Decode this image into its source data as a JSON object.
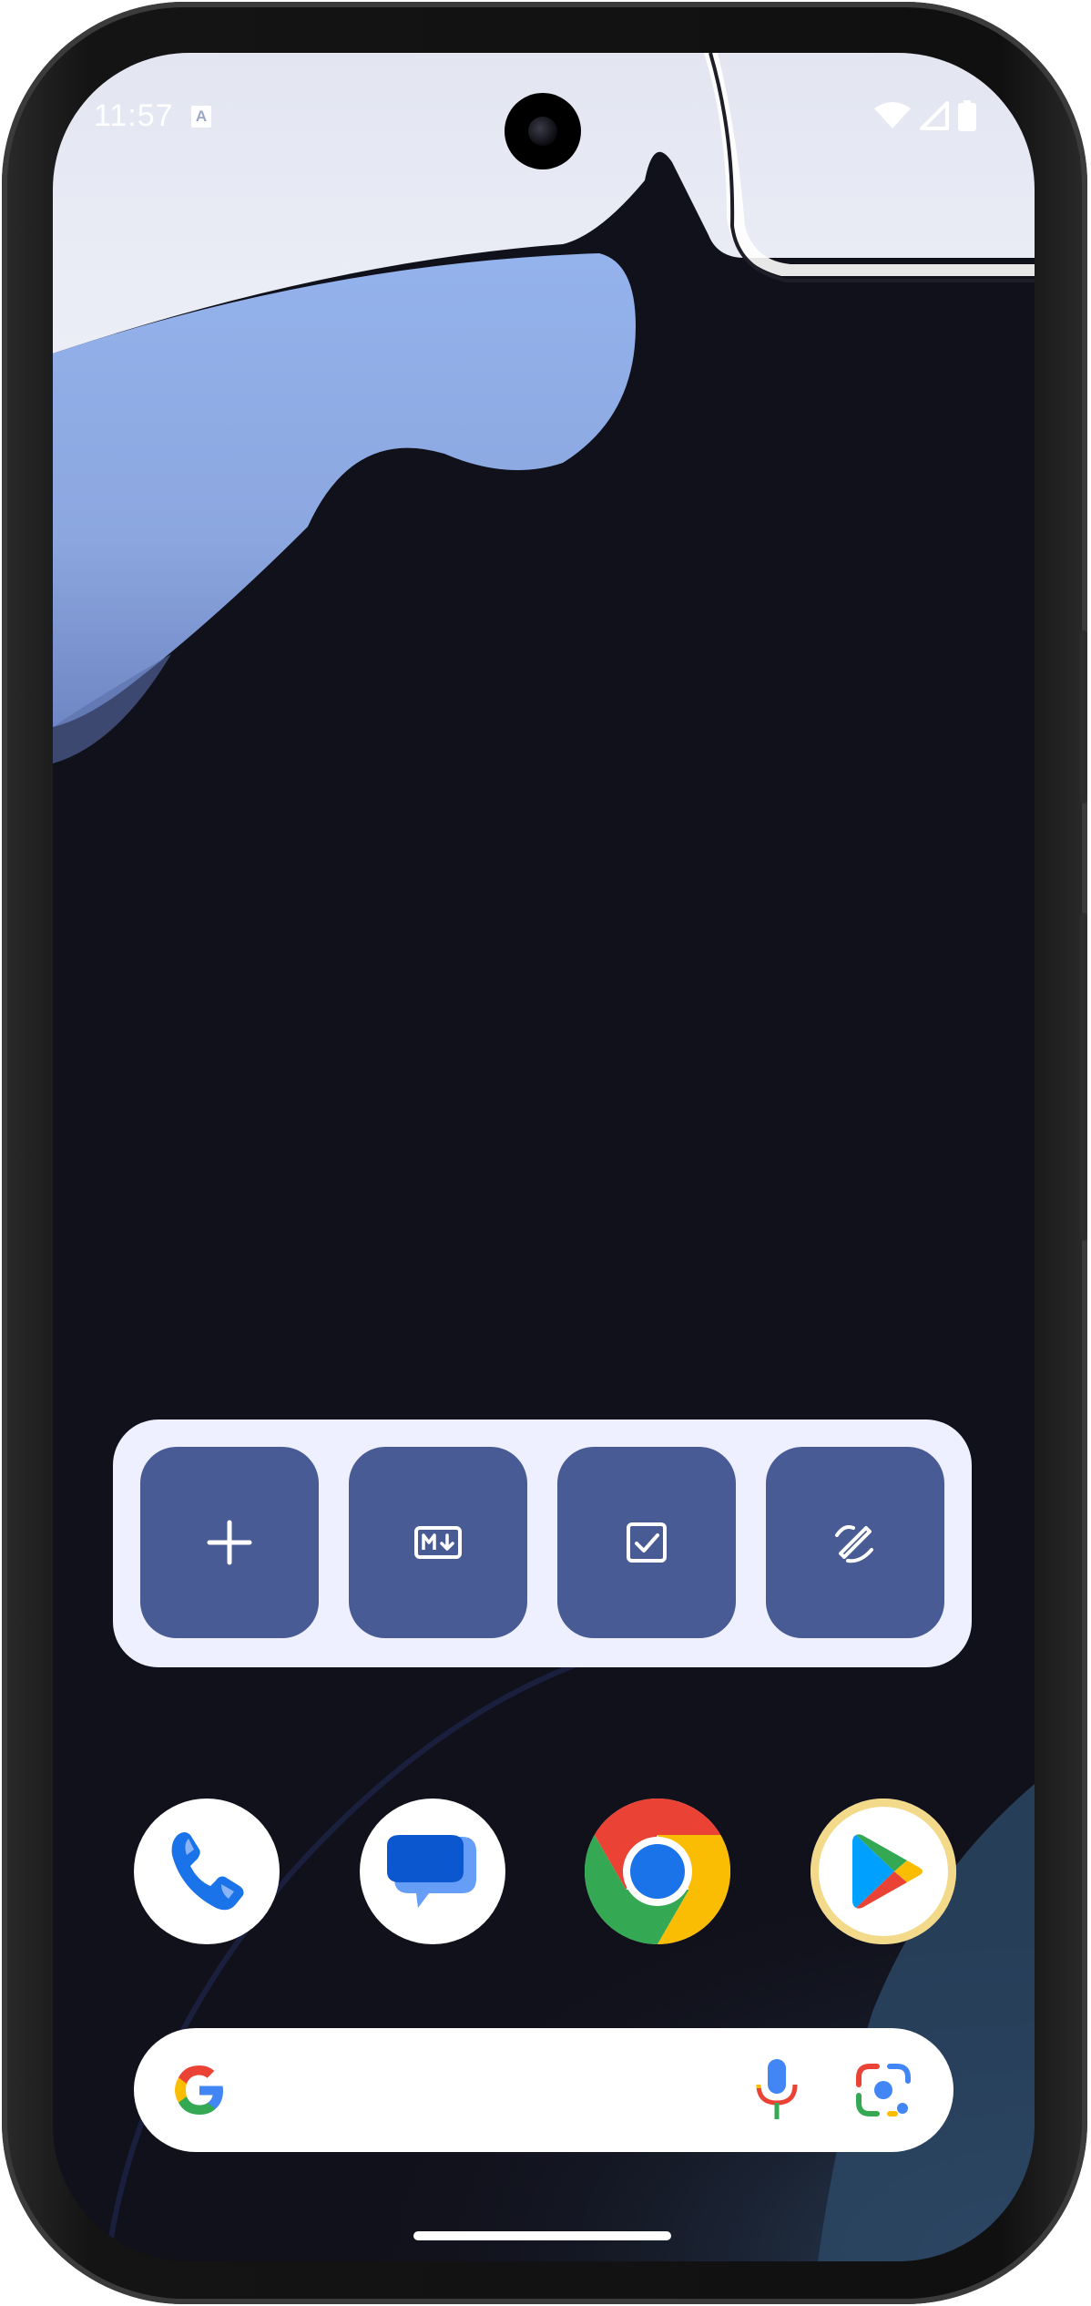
{
  "status_bar": {
    "time": "11:57",
    "indicator": "A"
  },
  "colors": {
    "widget_bg": "#eef0ff",
    "widget_button": "#485b94",
    "wallpaper_dark": "#11111b",
    "wallpaper_light": "#e6e9f4",
    "wallpaper_blue": "#8aa7e2"
  },
  "widget": {
    "buttons": [
      {
        "icon": "plus-icon"
      },
      {
        "icon": "markdown-download-icon"
      },
      {
        "icon": "checkbox-icon"
      },
      {
        "icon": "draw-pen-icon"
      }
    ]
  },
  "dock": {
    "apps": [
      {
        "icon": "phone-app-icon"
      },
      {
        "icon": "messages-app-icon"
      },
      {
        "icon": "chrome-app-icon"
      },
      {
        "icon": "play-store-app-icon"
      }
    ]
  },
  "search": {
    "left_icon": "google-g-icon",
    "mic_icon": "microphone-icon",
    "lens_icon": "google-lens-icon"
  }
}
